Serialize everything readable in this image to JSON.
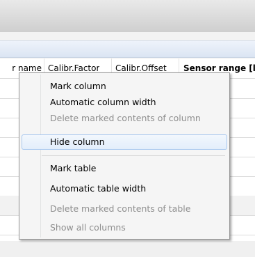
{
  "table": {
    "headers": [
      {
        "label": "r name",
        "bold": false
      },
      {
        "label": "Calibr.Factor",
        "bold": false
      },
      {
        "label": "Calibr.Offset",
        "bold": false
      },
      {
        "label": "Sensor range [l",
        "bold": true
      }
    ]
  },
  "menu": {
    "items": [
      {
        "label": "Mark column",
        "enabled": true
      },
      {
        "label": "Automatic column width",
        "enabled": true
      },
      {
        "label": "Delete marked contents of column",
        "enabled": false
      },
      {
        "label": "Hide column",
        "enabled": true,
        "highlighted": true
      },
      {
        "label": "Mark table",
        "enabled": true
      },
      {
        "label": "Automatic table width",
        "enabled": true
      },
      {
        "label": "Delete marked contents of table",
        "enabled": false
      },
      {
        "label": "Show all columns",
        "enabled": false
      }
    ]
  },
  "colors": {
    "menu_background": "#f5f5f5",
    "disabled_text": "#8e8e8e",
    "highlight_border": "#a8c8ef"
  }
}
